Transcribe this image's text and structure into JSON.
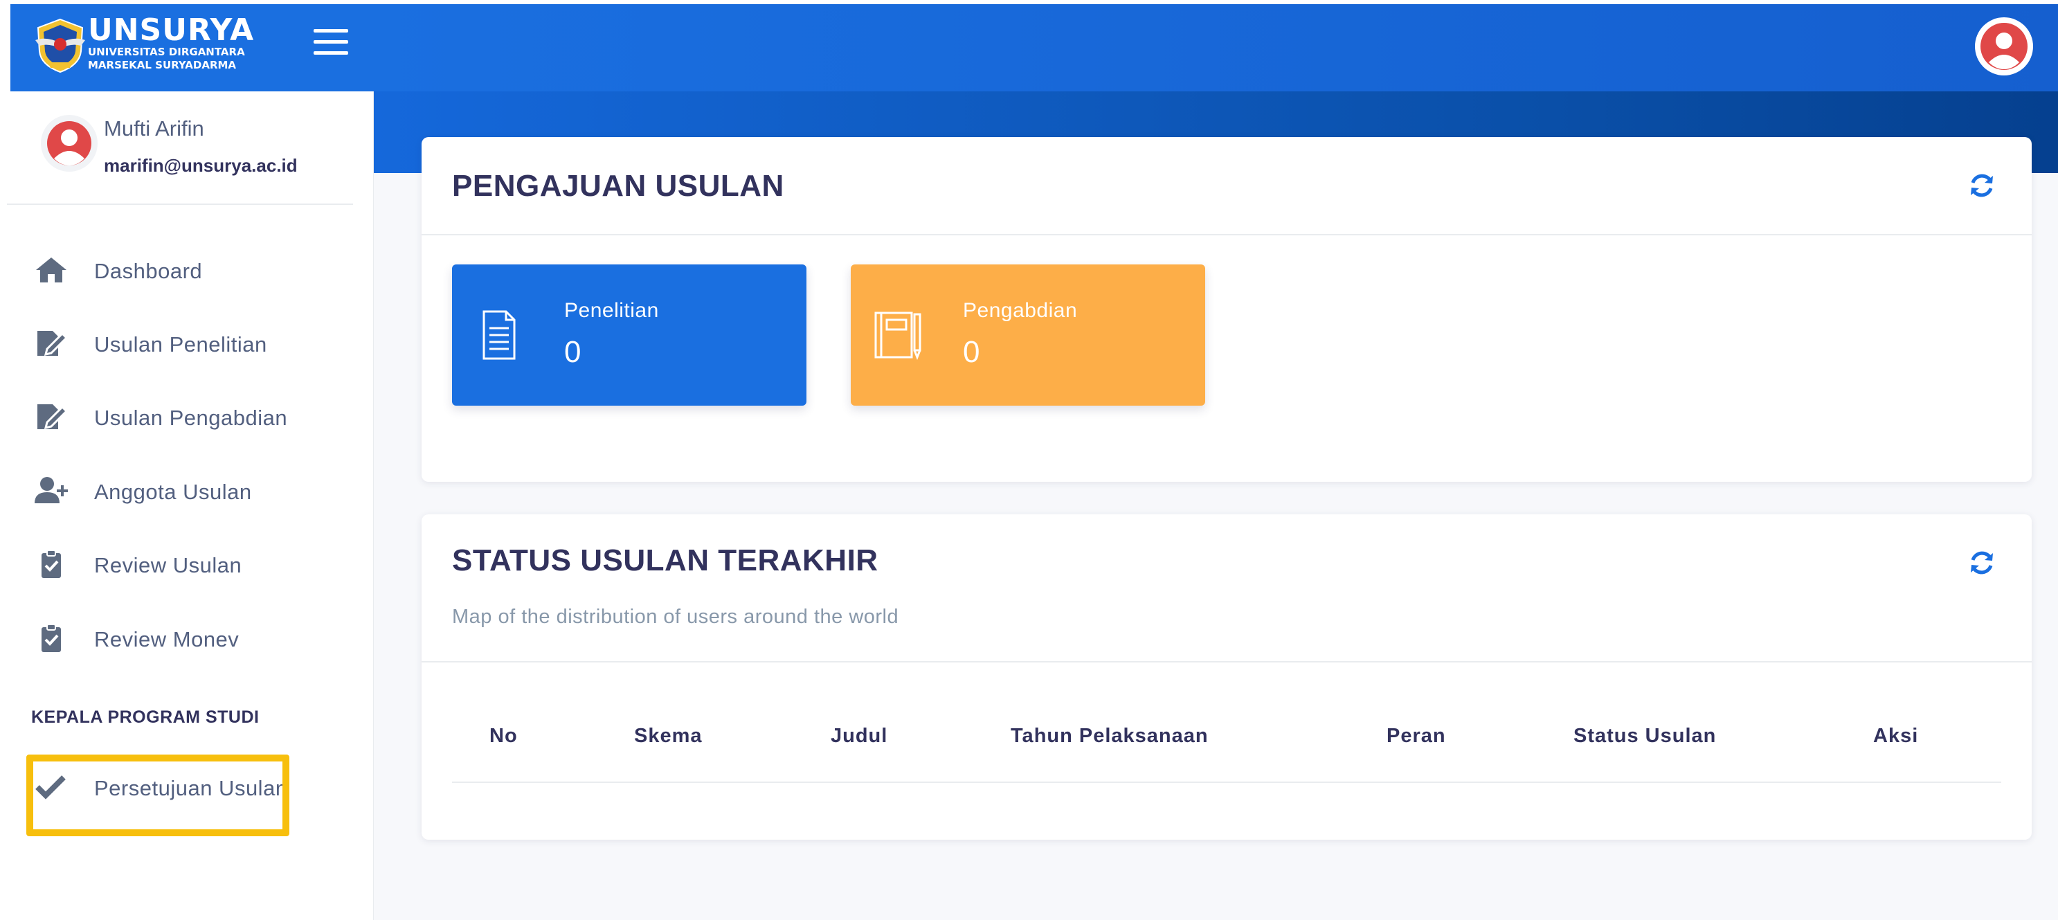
{
  "brand": {
    "name": "UNSURYA",
    "subtitle_line1": "UNIVERSITAS DIRGANTARA",
    "subtitle_line2": "MARSEKAL SURYADARMA",
    "logo_icon": "university-crest-icon",
    "menu_icon": "hamburger-menu-icon"
  },
  "user": {
    "name": "Mufti Arifin",
    "email": "marifin@unsurya.ac.id",
    "avatar_icon": "user-avatar-icon"
  },
  "sidebar": {
    "items": [
      {
        "label": "Dashboard",
        "icon": "home-icon"
      },
      {
        "label": "Usulan Penelitian",
        "icon": "edit-document-icon"
      },
      {
        "label": "Usulan Pengabdian",
        "icon": "edit-document-icon"
      },
      {
        "label": "Anggota Usulan",
        "icon": "user-plus-icon"
      },
      {
        "label": "Review Usulan",
        "icon": "clipboard-check-icon"
      },
      {
        "label": "Review Monev",
        "icon": "clipboard-check-icon"
      }
    ],
    "section_heading": "KEPALA PROGRAM STUDI",
    "section_items": [
      {
        "label": "Persetujuan Usulan",
        "icon": "check-icon"
      }
    ],
    "highlight_color": "#f7bf0d"
  },
  "colors": {
    "primary": "#1a6fe0",
    "warning": "#fdae48",
    "text_dark": "#32325d",
    "text_muted": "#8898aa"
  },
  "cards": {
    "pengajuan": {
      "title": "PENGAJUAN USULAN",
      "refresh_icon": "refresh-icon",
      "stats": [
        {
          "label": "Penelitian",
          "value": "0",
          "icon": "document-icon",
          "color": "#1a6fe0"
        },
        {
          "label": "Pengabdian",
          "value": "0",
          "icon": "notebook-pen-icon",
          "color": "#fdae48"
        }
      ]
    },
    "status": {
      "title": "STATUS USULAN TERAKHIR",
      "subtitle": "Map of the distribution of users around the world",
      "refresh_icon": "refresh-icon",
      "columns": [
        "No",
        "Skema",
        "Judul",
        "Tahun Pelaksanaan",
        "Peran",
        "Status Usulan",
        "Aksi"
      ]
    }
  }
}
